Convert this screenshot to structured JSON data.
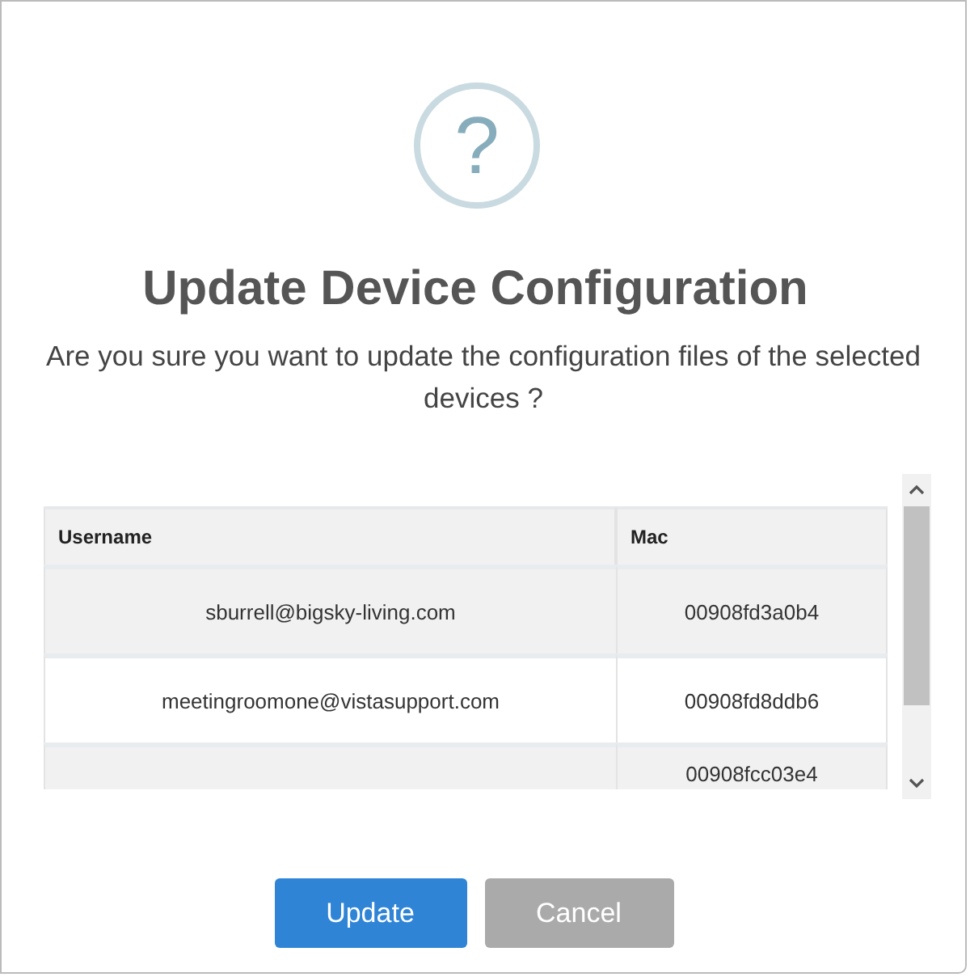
{
  "dialog": {
    "icon": "?",
    "title": "Update Device Configuration",
    "message": "Are you sure you want to update the configuration files of the selected devices ?"
  },
  "table": {
    "columns": [
      "Username",
      "Mac"
    ],
    "rows": [
      {
        "username": "sburrell@bigsky-living.com",
        "mac": "00908fd3a0b4"
      },
      {
        "username": "meetingroomone@vistasupport.com",
        "mac": "00908fd8ddb6"
      },
      {
        "username": "",
        "mac": "00908fcc03e4"
      }
    ]
  },
  "buttons": [
    {
      "kind": "primary",
      "label": "Update"
    },
    {
      "kind": "secondary",
      "label": "Cancel"
    }
  ]
}
